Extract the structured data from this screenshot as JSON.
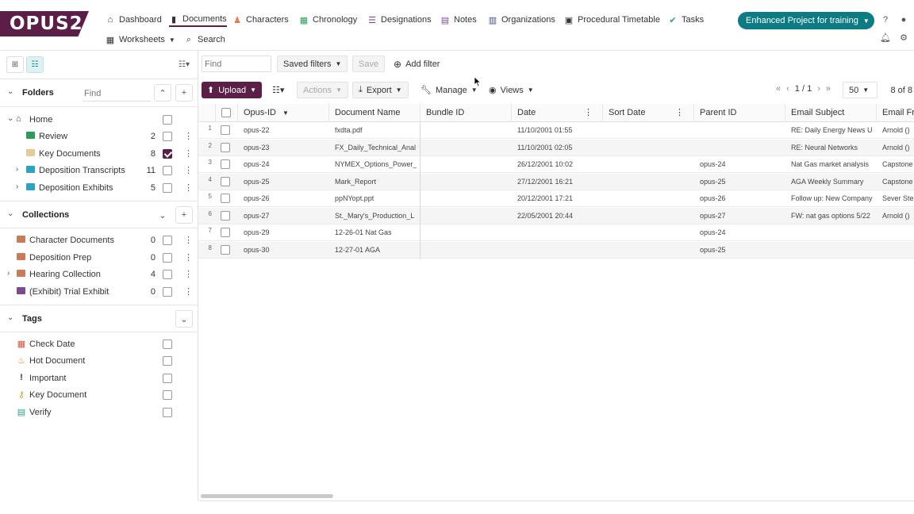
{
  "app": {
    "logo": "OPUS2",
    "project_button": "Enhanced Project for training"
  },
  "nav": {
    "dashboard": "Dashboard",
    "documents": "Documents",
    "characters": "Characters",
    "chronology": "Chronology",
    "designations": "Designations",
    "notes": "Notes",
    "organizations": "Organizations",
    "procedural_timetable": "Procedural Timetable",
    "tasks": "Tasks",
    "worksheets": "Worksheets",
    "search": "Search"
  },
  "colors": {
    "brand": "#5b1e46",
    "accent": "#0c7c84"
  },
  "sidebar": {
    "folders_title": "Folders",
    "find_placeholder": "Find",
    "home": "Home",
    "folders": [
      {
        "label": "Review",
        "count": "2",
        "checked": false
      },
      {
        "label": "Key Documents",
        "count": "8",
        "checked": true
      },
      {
        "label": "Deposition Transcripts",
        "count": "11",
        "checked": false
      },
      {
        "label": "Deposition Exhibits",
        "count": "5",
        "checked": false
      }
    ],
    "collections_title": "Collections",
    "collections": [
      {
        "label": "Character Documents",
        "count": "0"
      },
      {
        "label": "Deposition Prep",
        "count": "0"
      },
      {
        "label": "Hearing Collection",
        "count": "4"
      },
      {
        "label": "(Exhibit) Trial Exhibit",
        "count": "0"
      }
    ],
    "tags_title": "Tags",
    "tags": [
      {
        "label": "Check Date",
        "icon": "calendar-icon"
      },
      {
        "label": "Hot Document",
        "icon": "fire-icon"
      },
      {
        "label": "Important",
        "icon": "exclamation-icon"
      },
      {
        "label": "Key Document",
        "icon": "key-icon"
      },
      {
        "label": "Verify",
        "icon": "verify-icon"
      }
    ]
  },
  "toolbar": {
    "find_placeholder": "Find",
    "saved_filters": "Saved filters",
    "save": "Save",
    "add_filter": "Add filter",
    "upload": "Upload",
    "actions": "Actions",
    "export": "Export",
    "manage": "Manage",
    "views": "Views",
    "page": "1 / 1",
    "page_size": "50",
    "total": "8 of 8"
  },
  "grid": {
    "columns": [
      "Opus-ID",
      "Document Name",
      "Bundle ID",
      "Date",
      "Sort Date",
      "Parent ID",
      "Email Subject",
      "Email Fr"
    ],
    "rows": [
      {
        "n": "1",
        "id": "opus-22",
        "name": "fxdta.pdf",
        "bundle": "",
        "date": "11/10/2001 01:55",
        "sort": "",
        "parent": "",
        "subject": "RE: Daily Energy News U",
        "from": "Arnold ()"
      },
      {
        "n": "2",
        "id": "opus-23",
        "name": "FX_Daily_Technical_Anal",
        "bundle": "",
        "date": "11/10/2001 02:05",
        "sort": "",
        "parent": "",
        "subject": "RE: Neural Networks",
        "from": "Arnold ()"
      },
      {
        "n": "3",
        "id": "opus-24",
        "name": "NYMEX_Options_Power_",
        "bundle": "",
        "date": "26/12/2001 10:02",
        "sort": "",
        "parent": "opus-24",
        "subject": "Nat Gas market analysis",
        "from": "Capstone"
      },
      {
        "n": "4",
        "id": "opus-25",
        "name": "Mark_Report",
        "bundle": "",
        "date": "27/12/2001 16:21",
        "sort": "",
        "parent": "opus-25",
        "subject": "AGA Weekly Summary",
        "from": "Capstone"
      },
      {
        "n": "5",
        "id": "opus-26",
        "name": "ppNYopt.ppt",
        "bundle": "",
        "date": "20/12/2001 17:21",
        "sort": "",
        "parent": "opus-26",
        "subject": "Follow up: New Company",
        "from": "Sever Ste"
      },
      {
        "n": "6",
        "id": "opus-27",
        "name": "St._Mary's_Production_L",
        "bundle": "",
        "date": "22/05/2001 20:44",
        "sort": "",
        "parent": "opus-27",
        "subject": "FW: nat gas options 5/22",
        "from": "Arnold ()"
      },
      {
        "n": "7",
        "id": "opus-29",
        "name": "12-26-01 Nat Gas",
        "bundle": "",
        "date": "",
        "sort": "",
        "parent": "opus-24",
        "subject": "",
        "from": ""
      },
      {
        "n": "8",
        "id": "opus-30",
        "name": "12-27-01 AGA",
        "bundle": "",
        "date": "",
        "sort": "",
        "parent": "opus-25",
        "subject": "",
        "from": ""
      }
    ]
  }
}
